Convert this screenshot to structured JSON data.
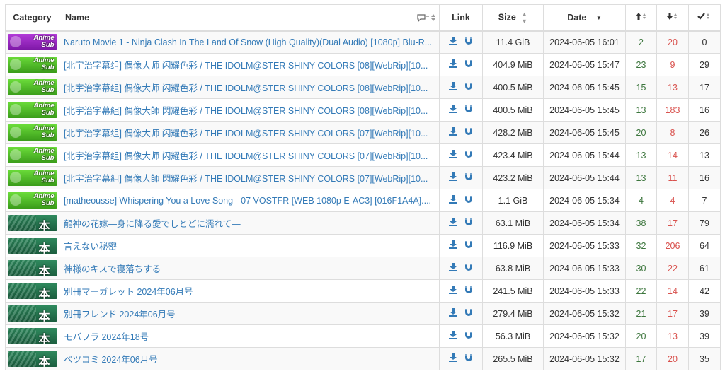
{
  "columns": {
    "category": "Category",
    "name": "Name",
    "link": "Link",
    "size": "Size",
    "date": "Date",
    "seeders_icon": "arrow-up-icon",
    "leechers_icon": "arrow-down-icon",
    "completed_icon": "check-icon"
  },
  "badges": {
    "anime_sub_line1": "Anime",
    "anime_sub_line2": "Sub",
    "book": "本"
  },
  "rows": [
    {
      "cat": "purple",
      "name": "Naruto Movie 1 - Ninja Clash In The Land Of Snow (High Quality)(Dual Audio) [1080p] Blu-R...",
      "size": "11.4 GiB",
      "date": "2024-06-05 16:01",
      "s": "2",
      "l": "20",
      "c": "0"
    },
    {
      "cat": "green",
      "name": "[北宇治字幕组] 偶像大师 闪耀色彩 / THE IDOLM@STER SHINY COLORS [08][WebRip][10...",
      "size": "404.9 MiB",
      "date": "2024-06-05 15:47",
      "s": "23",
      "l": "9",
      "c": "29"
    },
    {
      "cat": "green",
      "name": "[北宇治字幕组] 偶像大师 闪耀色彩 / THE IDOLM@STER SHINY COLORS [08][WebRip][10...",
      "size": "400.5 MiB",
      "date": "2024-06-05 15:45",
      "s": "15",
      "l": "13",
      "c": "17"
    },
    {
      "cat": "green",
      "name": "[北宇治字幕組] 偶像大師 閃耀色彩 / THE IDOLM@STER SHINY COLORS [08][WebRip][10...",
      "size": "400.5 MiB",
      "date": "2024-06-05 15:45",
      "s": "13",
      "l": "183",
      "c": "16"
    },
    {
      "cat": "green",
      "name": "[北宇治字幕组] 偶像大师 闪耀色彩 / THE IDOLM@STER SHINY COLORS [07][WebRip][10...",
      "size": "428.2 MiB",
      "date": "2024-06-05 15:45",
      "s": "20",
      "l": "8",
      "c": "26"
    },
    {
      "cat": "green",
      "name": "[北宇治字幕组] 偶像大师 闪耀色彩 / THE IDOLM@STER SHINY COLORS [07][WebRip][10...",
      "size": "423.4 MiB",
      "date": "2024-06-05 15:44",
      "s": "13",
      "l": "14",
      "c": "13"
    },
    {
      "cat": "green",
      "name": "[北宇治字幕組] 偶像大師 閃耀色彩 / THE IDOLM@STER SHINY COLORS [07][WebRip][10...",
      "size": "423.2 MiB",
      "date": "2024-06-05 15:44",
      "s": "13",
      "l": "11",
      "c": "16"
    },
    {
      "cat": "green",
      "name": "[matheousse] Whispering You a Love Song - 07 VOSTFR [WEB 1080p E-AC3] [016F1A4A]....",
      "size": "1.1 GiB",
      "date": "2024-06-05 15:34",
      "s": "4",
      "l": "4",
      "c": "7"
    },
    {
      "cat": "teal",
      "name": "龍神の花嫁―身に降る愛でしとどに濡れて―",
      "size": "63.1 MiB",
      "date": "2024-06-05 15:34",
      "s": "38",
      "l": "17",
      "c": "79"
    },
    {
      "cat": "teal",
      "name": "言えない秘密",
      "size": "116.9 MiB",
      "date": "2024-06-05 15:33",
      "s": "32",
      "l": "206",
      "c": "64"
    },
    {
      "cat": "teal",
      "name": "神様のキスで寝落ちする",
      "size": "63.8 MiB",
      "date": "2024-06-05 15:33",
      "s": "30",
      "l": "22",
      "c": "61"
    },
    {
      "cat": "teal",
      "name": "別冊マーガレット 2024年06月号",
      "size": "241.5 MiB",
      "date": "2024-06-05 15:33",
      "s": "22",
      "l": "14",
      "c": "42"
    },
    {
      "cat": "teal",
      "name": "別冊フレンド 2024年06月号",
      "size": "279.4 MiB",
      "date": "2024-06-05 15:32",
      "s": "21",
      "l": "17",
      "c": "39"
    },
    {
      "cat": "teal",
      "name": "モバフラ 2024年18号",
      "size": "56.3 MiB",
      "date": "2024-06-05 15:32",
      "s": "20",
      "l": "13",
      "c": "39"
    },
    {
      "cat": "teal",
      "name": "ベツコミ 2024年06月号",
      "size": "265.5 MiB",
      "date": "2024-06-05 15:32",
      "s": "17",
      "l": "20",
      "c": "35"
    }
  ]
}
